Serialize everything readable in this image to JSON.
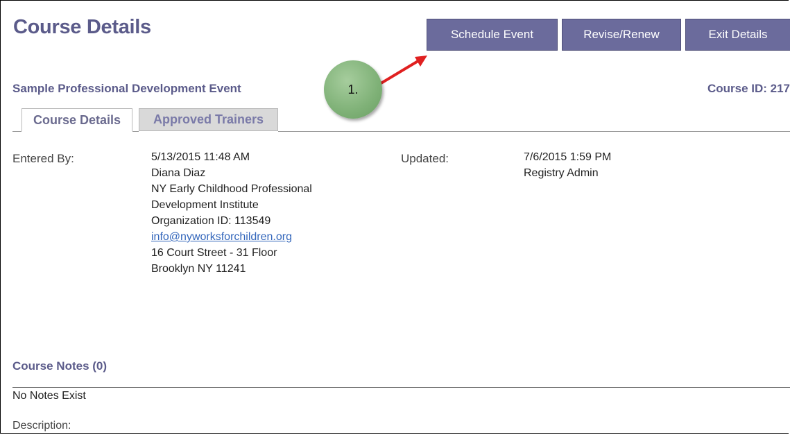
{
  "page": {
    "title": "Course Details"
  },
  "buttons": {
    "schedule_event": "Schedule Event",
    "revise_renew": "Revise/Renew",
    "exit_details": "Exit Details"
  },
  "course": {
    "name": "Sample Professional Development Event",
    "id_label": "Course ID: 217"
  },
  "tabs": [
    {
      "label": "Course Details",
      "active": true
    },
    {
      "label": "Approved Trainers",
      "active": false
    }
  ],
  "entered": {
    "label": "Entered By:",
    "datetime": "5/13/2015 11:48 AM",
    "name": "Diana Diaz",
    "org_line1": "NY Early Childhood Professional",
    "org_line2": "Development Institute",
    "org_id": "Organization ID: 113549",
    "email": "info@nyworksforchildren.org",
    "address1": "16 Court Street - 31 Floor",
    "address2": "Brooklyn NY 11241"
  },
  "updated": {
    "label": "Updated:",
    "datetime": "7/6/2015 1:59 PM",
    "by": "Registry Admin"
  },
  "notes": {
    "title": "Course Notes (0)",
    "empty_text": "No Notes Exist"
  },
  "description": {
    "label": "Description:"
  },
  "annotation": {
    "callout_text": "1."
  },
  "colors": {
    "accent": "#5b5b8a",
    "button_bg": "#6b6b9c",
    "callout_green": "#7fb177",
    "arrow_red": "#e02020",
    "link": "#3366bb"
  },
  "icons": {
    "annotation_arrow": "red-arrow-icon"
  }
}
